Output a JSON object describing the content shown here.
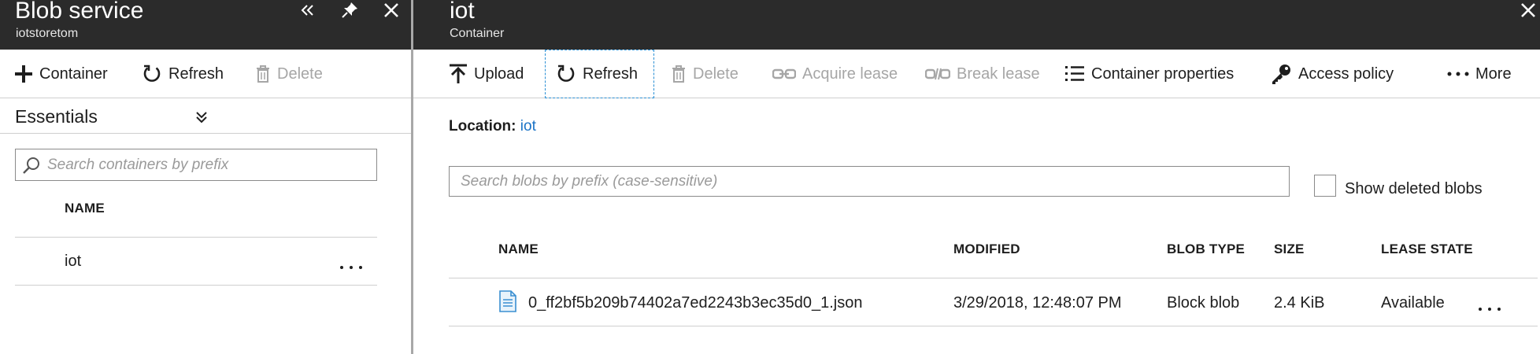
{
  "left_blade": {
    "title": "Blob service",
    "subtitle": "iotstoretom",
    "toolbar": {
      "container_label": "Container",
      "refresh_label": "Refresh",
      "delete_label": "Delete"
    },
    "essentials_label": "Essentials",
    "search": {
      "placeholder": "Search containers by prefix"
    },
    "table": {
      "header_name": "NAME",
      "rows": [
        {
          "name": "iot"
        }
      ]
    }
  },
  "right_blade": {
    "title": "iot",
    "subtitle": "Container",
    "toolbar": {
      "upload_label": "Upload",
      "refresh_label": "Refresh",
      "delete_label": "Delete",
      "acquire_lease_label": "Acquire lease",
      "break_lease_label": "Break lease",
      "container_properties_label": "Container properties",
      "access_policy_label": "Access policy",
      "more_label": "More"
    },
    "location": {
      "label": "Location:",
      "value": "iot"
    },
    "search": {
      "placeholder": "Search blobs by prefix (case-sensitive)"
    },
    "show_deleted_label": "Show deleted blobs",
    "table": {
      "headers": {
        "name": "NAME",
        "modified": "MODIFIED",
        "blob_type": "BLOB TYPE",
        "size": "SIZE",
        "lease_state": "LEASE STATE"
      },
      "rows": [
        {
          "name": "0_ff2bf5b209b74402a7ed2243b3ec35d0_1.json",
          "modified": "3/29/2018, 12:48:07 PM",
          "blob_type": "Block blob",
          "size": "2.4 KiB",
          "lease_state": "Available"
        }
      ]
    }
  },
  "icons": {
    "collapse": "double-chevron-left-icon",
    "pin": "pin-icon",
    "close": "close-icon",
    "add": "plus-icon",
    "refresh": "refresh-icon",
    "delete": "trash-icon",
    "upload": "upload-icon",
    "acquire_lease": "link-icon",
    "break_lease": "broken-link-icon",
    "properties": "list-icon",
    "access_policy": "key-icon",
    "more": "ellipsis-icon",
    "file": "document-icon",
    "search": "search-icon"
  },
  "colors": {
    "header_bg": "#2b2b2b",
    "link": "#1a73c6",
    "disabled": "#a6a6a6",
    "focus_outline": "#2a8fd4"
  }
}
